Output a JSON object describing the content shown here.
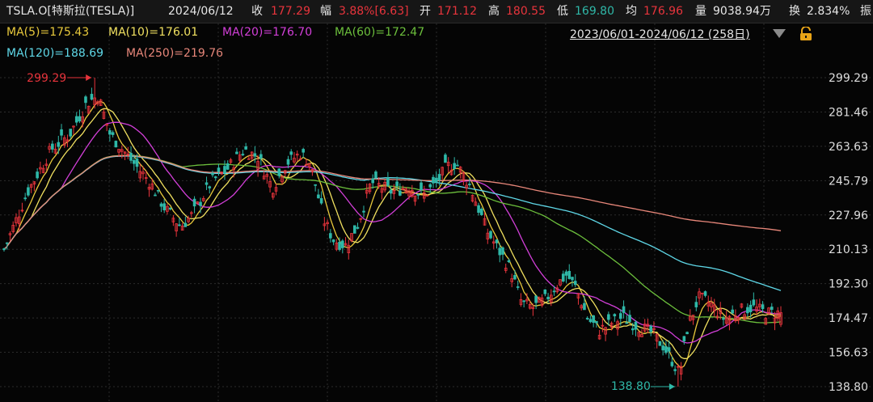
{
  "header": {
    "symbol": "TSLA.O[特斯拉(TESLA)]",
    "date": "2024/06/12",
    "close_label": "收",
    "close_value": "177.29",
    "change_label": "幅",
    "change_value": "3.88%[6.63]",
    "open_label": "开",
    "open_value": "171.12",
    "high_label": "高",
    "high_value": "180.55",
    "low_label": "低",
    "low_value": "169.80",
    "avg_label": "均",
    "avg_value": "176.96",
    "volume_label": "量",
    "volume_value": "9038.94万",
    "turnover_label": "换",
    "turnover_value": "2.834%",
    "amplitude_label": "振"
  },
  "ma_legend": [
    {
      "label": "MA(5)=175.43",
      "color": "#e8c93c"
    },
    {
      "label": "MA(10)=176.01",
      "color": "#f0e060"
    },
    {
      "label": "MA(20)=176.70",
      "color": "#d23fd8"
    },
    {
      "label": "MA(60)=172.47",
      "color": "#6cbf3c"
    },
    {
      "label": "MA(120)=188.69",
      "color": "#5fd8e8"
    },
    {
      "label": "MA(250)=219.76",
      "color": "#e8877a"
    }
  ],
  "date_range": "2023/06/01-2024/06/12 (258日)",
  "colors": {
    "up": "#e8343c",
    "down": "#2fb8a8",
    "grid": "#2c2c2c",
    "axis_text": "#dddddd",
    "background": "#050505"
  },
  "icons": {
    "dropdown": "triangle-down-icon",
    "lock": "lock-icon"
  },
  "chart_data": {
    "type": "candlestick",
    "symbol": "TSLA.O",
    "range": [
      "2023/06/01",
      "2024/06/12"
    ],
    "trading_days": 258,
    "ylim": [
      138.8,
      299.29
    ],
    "y_ticks": [
      299.29,
      281.46,
      263.63,
      245.79,
      227.96,
      210.13,
      192.3,
      174.47,
      156.63,
      138.8
    ],
    "price_anchors": [
      [
        0,
        210
      ],
      [
        10,
        240
      ],
      [
        20,
        262
      ],
      [
        28,
        270
      ],
      [
        35,
        286
      ],
      [
        40,
        290
      ],
      [
        45,
        270
      ],
      [
        55,
        255
      ],
      [
        62,
        245
      ],
      [
        68,
        232
      ],
      [
        75,
        222
      ],
      [
        80,
        228
      ],
      [
        88,
        245
      ],
      [
        95,
        252
      ],
      [
        102,
        262
      ],
      [
        108,
        258
      ],
      [
        114,
        242
      ],
      [
        120,
        255
      ],
      [
        126,
        260
      ],
      [
        130,
        255
      ],
      [
        136,
        225
      ],
      [
        140,
        215
      ],
      [
        145,
        212
      ],
      [
        150,
        222
      ],
      [
        156,
        245
      ],
      [
        165,
        240
      ],
      [
        172,
        243
      ],
      [
        178,
        238
      ],
      [
        184,
        245
      ],
      [
        188,
        253
      ],
      [
        192,
        255
      ],
      [
        198,
        243
      ],
      [
        205,
        220
      ],
      [
        210,
        210
      ],
      [
        215,
        200
      ],
      [
        220,
        182
      ],
      [
        225,
        180
      ],
      [
        230,
        184
      ],
      [
        235,
        192
      ],
      [
        239,
        197
      ],
      [
        243,
        190
      ],
      [
        248,
        174
      ],
      [
        253,
        168
      ],
      [
        258,
        172
      ],
      [
        263,
        175
      ],
      [
        268,
        171
      ],
      [
        275,
        167
      ],
      [
        280,
        160
      ],
      [
        284,
        152
      ],
      [
        287,
        145
      ],
      [
        290,
        168
      ],
      [
        295,
        185
      ],
      [
        300,
        182
      ],
      [
        306,
        174
      ],
      [
        312,
        178
      ],
      [
        318,
        180
      ],
      [
        324,
        177
      ],
      [
        330,
        177
      ]
    ],
    "ma_period_final": {
      "MA(5)": 175.43,
      "MA(10)": 176.01,
      "MA(20)": 176.7,
      "MA(60)": 172.47,
      "MA(120)": 188.69,
      "MA(250)": 219.76
    },
    "annotations": [
      {
        "text": "299.29",
        "type": "high_marker",
        "value": 299.29
      },
      {
        "text": "138.80",
        "type": "low_marker",
        "value": 138.8
      }
    ],
    "grid": true,
    "axis": "right"
  }
}
